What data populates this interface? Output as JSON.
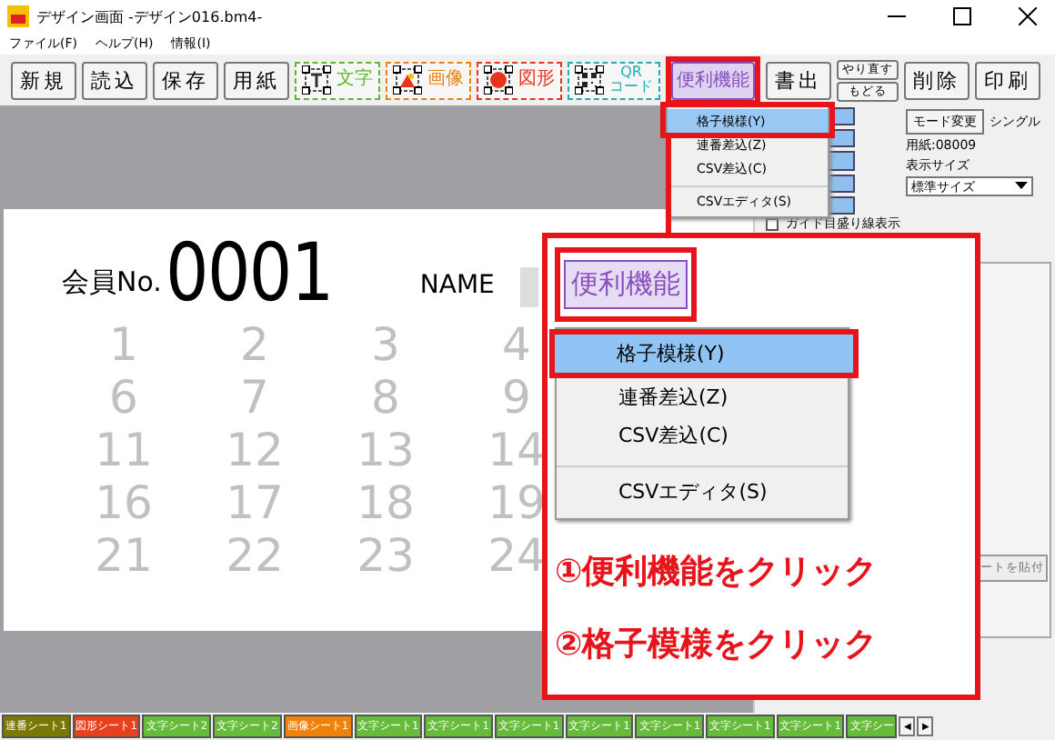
{
  "window": {
    "title": "デザイン画面 -デザイン016.bm4-"
  },
  "menu": [
    {
      "label": "ファイル(F)"
    },
    {
      "label": "ヘルプ(H)"
    },
    {
      "label": "情報(I)"
    }
  ],
  "toolbar": [
    {
      "kind": "plain",
      "label": "新規",
      "selected": false
    },
    {
      "kind": "plain",
      "label": "読込",
      "selected": false
    },
    {
      "kind": "plain",
      "label": "保存",
      "selected": false
    },
    {
      "kind": "plain",
      "label": "用紙",
      "selected": false
    },
    {
      "kind": "tool",
      "label": "文字",
      "color": "#5cb82e",
      "selected": false
    },
    {
      "kind": "tool",
      "label": "画像",
      "color": "#f08010",
      "selected": false
    },
    {
      "kind": "tool",
      "label": "図形",
      "color": "#e8341c",
      "selected": false
    },
    {
      "kind": "tool",
      "label": "QR\nコード",
      "color": "#20b0b0",
      "selected": false
    },
    {
      "kind": "plain",
      "label": "便利機能",
      "color": "#8a50c0",
      "selected": true
    },
    {
      "kind": "plain",
      "label": "書出",
      "selected": false
    },
    {
      "kind": "stacked",
      "labels": [
        "やり直す",
        "もどる"
      ],
      "selected": false
    },
    {
      "kind": "plain",
      "label": "削除",
      "selected": false
    },
    {
      "kind": "plain",
      "label": "印刷",
      "selected": false
    }
  ],
  "dropdown_menu": [
    {
      "label": "格子模様(Y)",
      "selected": true,
      "separator_before": false
    },
    {
      "label": "連番差込(Z)",
      "selected": false,
      "separator_before": false
    },
    {
      "label": "CSV差込(C)",
      "selected": false,
      "separator_before": false
    },
    {
      "label": "CSVエディタ(S)",
      "selected": false,
      "separator_before": true
    }
  ],
  "paper": {
    "member_label": "会員No.",
    "member_number": "0001",
    "name_label": "NAME",
    "grid_numbers": [
      [
        "1",
        "2",
        "3",
        "4"
      ],
      [
        "6",
        "7",
        "8",
        "9"
      ],
      [
        "11",
        "12",
        "13",
        "14"
      ],
      [
        "16",
        "17",
        "18",
        "19"
      ],
      [
        "21",
        "22",
        "23",
        "24"
      ]
    ]
  },
  "side_panel": {
    "mode_button": "モード変更",
    "mode": "シングル",
    "paper_code": "用紙:08009",
    "display_size_label": "表示サイズ",
    "display_size": "標準サイズ",
    "guide_checkbox": {
      "label": "ガイド目盛り線表示",
      "checked": false
    },
    "paste_button": "ートを貼付"
  },
  "callout": {
    "button": {
      "label": "便利機能",
      "selected": true
    },
    "menu": [
      {
        "label": "格子模様(Y)",
        "selected": true,
        "separator_before": false
      },
      {
        "label": "連番差込(Z)",
        "selected": false,
        "separator_before": false
      },
      {
        "label": "CSV差込(C)",
        "selected": false,
        "separator_before": false
      },
      {
        "label": "CSVエディタ(S)",
        "selected": false,
        "separator_before": true
      }
    ],
    "steps": [
      "①便利機能をクリック",
      "②格子模様をクリック"
    ]
  },
  "sheet_tabs": [
    {
      "label": "連番シート1",
      "color": "#7a7800"
    },
    {
      "label": "図形シート1",
      "color": "#e8401c"
    },
    {
      "label": "文字シート2",
      "color": "#66bb3a"
    },
    {
      "label": "文字シート2",
      "color": "#66bb3a"
    },
    {
      "label": "画像シート1",
      "color": "#f0820c"
    },
    {
      "label": "文字シート1",
      "color": "#66bb3a"
    },
    {
      "label": "文字シート1",
      "color": "#66bb3a"
    },
    {
      "label": "文字シート1",
      "color": "#66bb3a"
    },
    {
      "label": "文字シート1",
      "color": "#66bb3a"
    },
    {
      "label": "文字シート1",
      "color": "#66bb3a"
    },
    {
      "label": "文字シート1",
      "color": "#66bb3a"
    },
    {
      "label": "文字シート1",
      "color": "#66bb3a"
    },
    {
      "label": "文字シー",
      "color": "#66bb3a"
    }
  ],
  "tab_scroll": [
    "◀",
    "▶"
  ]
}
